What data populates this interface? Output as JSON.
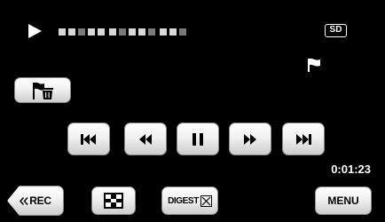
{
  "status": {
    "mode_icon": "play-icon",
    "media_label": "SD",
    "flag_icon": "flag-icon",
    "elapsed_time": "0:01:23"
  },
  "buttons": {
    "delete_flag_icon": "trash-flag-icon",
    "prev_icon": "skip-previous-icon",
    "rewind_icon": "rewind-icon",
    "pause_icon": "pause-icon",
    "forward_icon": "fast-forward-icon",
    "next_icon": "skip-next-icon",
    "rec_label": "REC",
    "thumbnail_icon": "checkerboard-icon",
    "digest_label": "DIGEST",
    "menu_label": "MENU"
  },
  "colors": {
    "background": "#000000",
    "button_face": "#f1f1f1",
    "button_edge": "#8a8a8a"
  }
}
